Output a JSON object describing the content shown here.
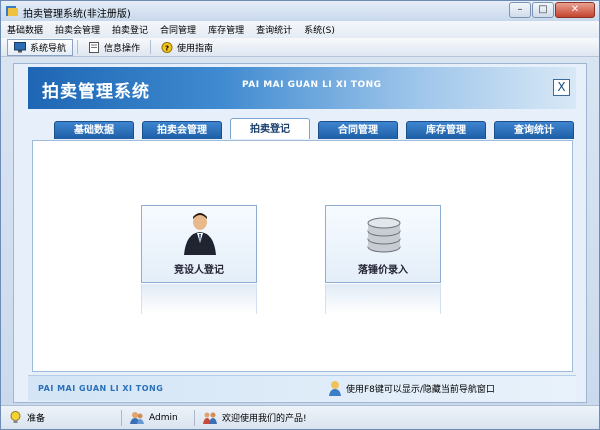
{
  "window": {
    "title": "拍卖管理系统(非注册版)",
    "minimize": "–",
    "maximize": "□",
    "close": "✕"
  },
  "menu": [
    "基础数据",
    "拍卖会管理",
    "拍卖登记",
    "合同管理",
    "库存管理",
    "查询统计",
    "系统(S)"
  ],
  "toolbar": [
    {
      "label": "系统导航",
      "icon": "monitor-icon",
      "active": true
    },
    {
      "label": "信息操作",
      "icon": "document-icon",
      "active": false
    },
    {
      "label": "使用指南",
      "icon": "help-icon",
      "active": false
    }
  ],
  "panel": {
    "title": "拍卖管理系统",
    "pinyin": "PAI MAI GUAN LI XI TONG",
    "close": "X"
  },
  "tabs": [
    "基础数据",
    "拍卖会管理",
    "拍卖登记",
    "合同管理",
    "库存管理",
    "查询统计"
  ],
  "active_tab": "拍卖登记",
  "cards": [
    {
      "label": "竞设人登记",
      "icon": "person-icon"
    },
    {
      "label": "落锤价录入",
      "icon": "coin-stack-icon"
    }
  ],
  "footer": {
    "pinyin": "PAI MAI GUAN LI XI TONG",
    "hint": "使用F8键可以显示/隐藏当前导航窗口"
  },
  "status": {
    "ready": "准备",
    "user": "Admin",
    "welcome": "欢迎使用我们的产品!"
  },
  "colors": {
    "accent": "#1e66b4",
    "tab": "#2a6fbf"
  }
}
